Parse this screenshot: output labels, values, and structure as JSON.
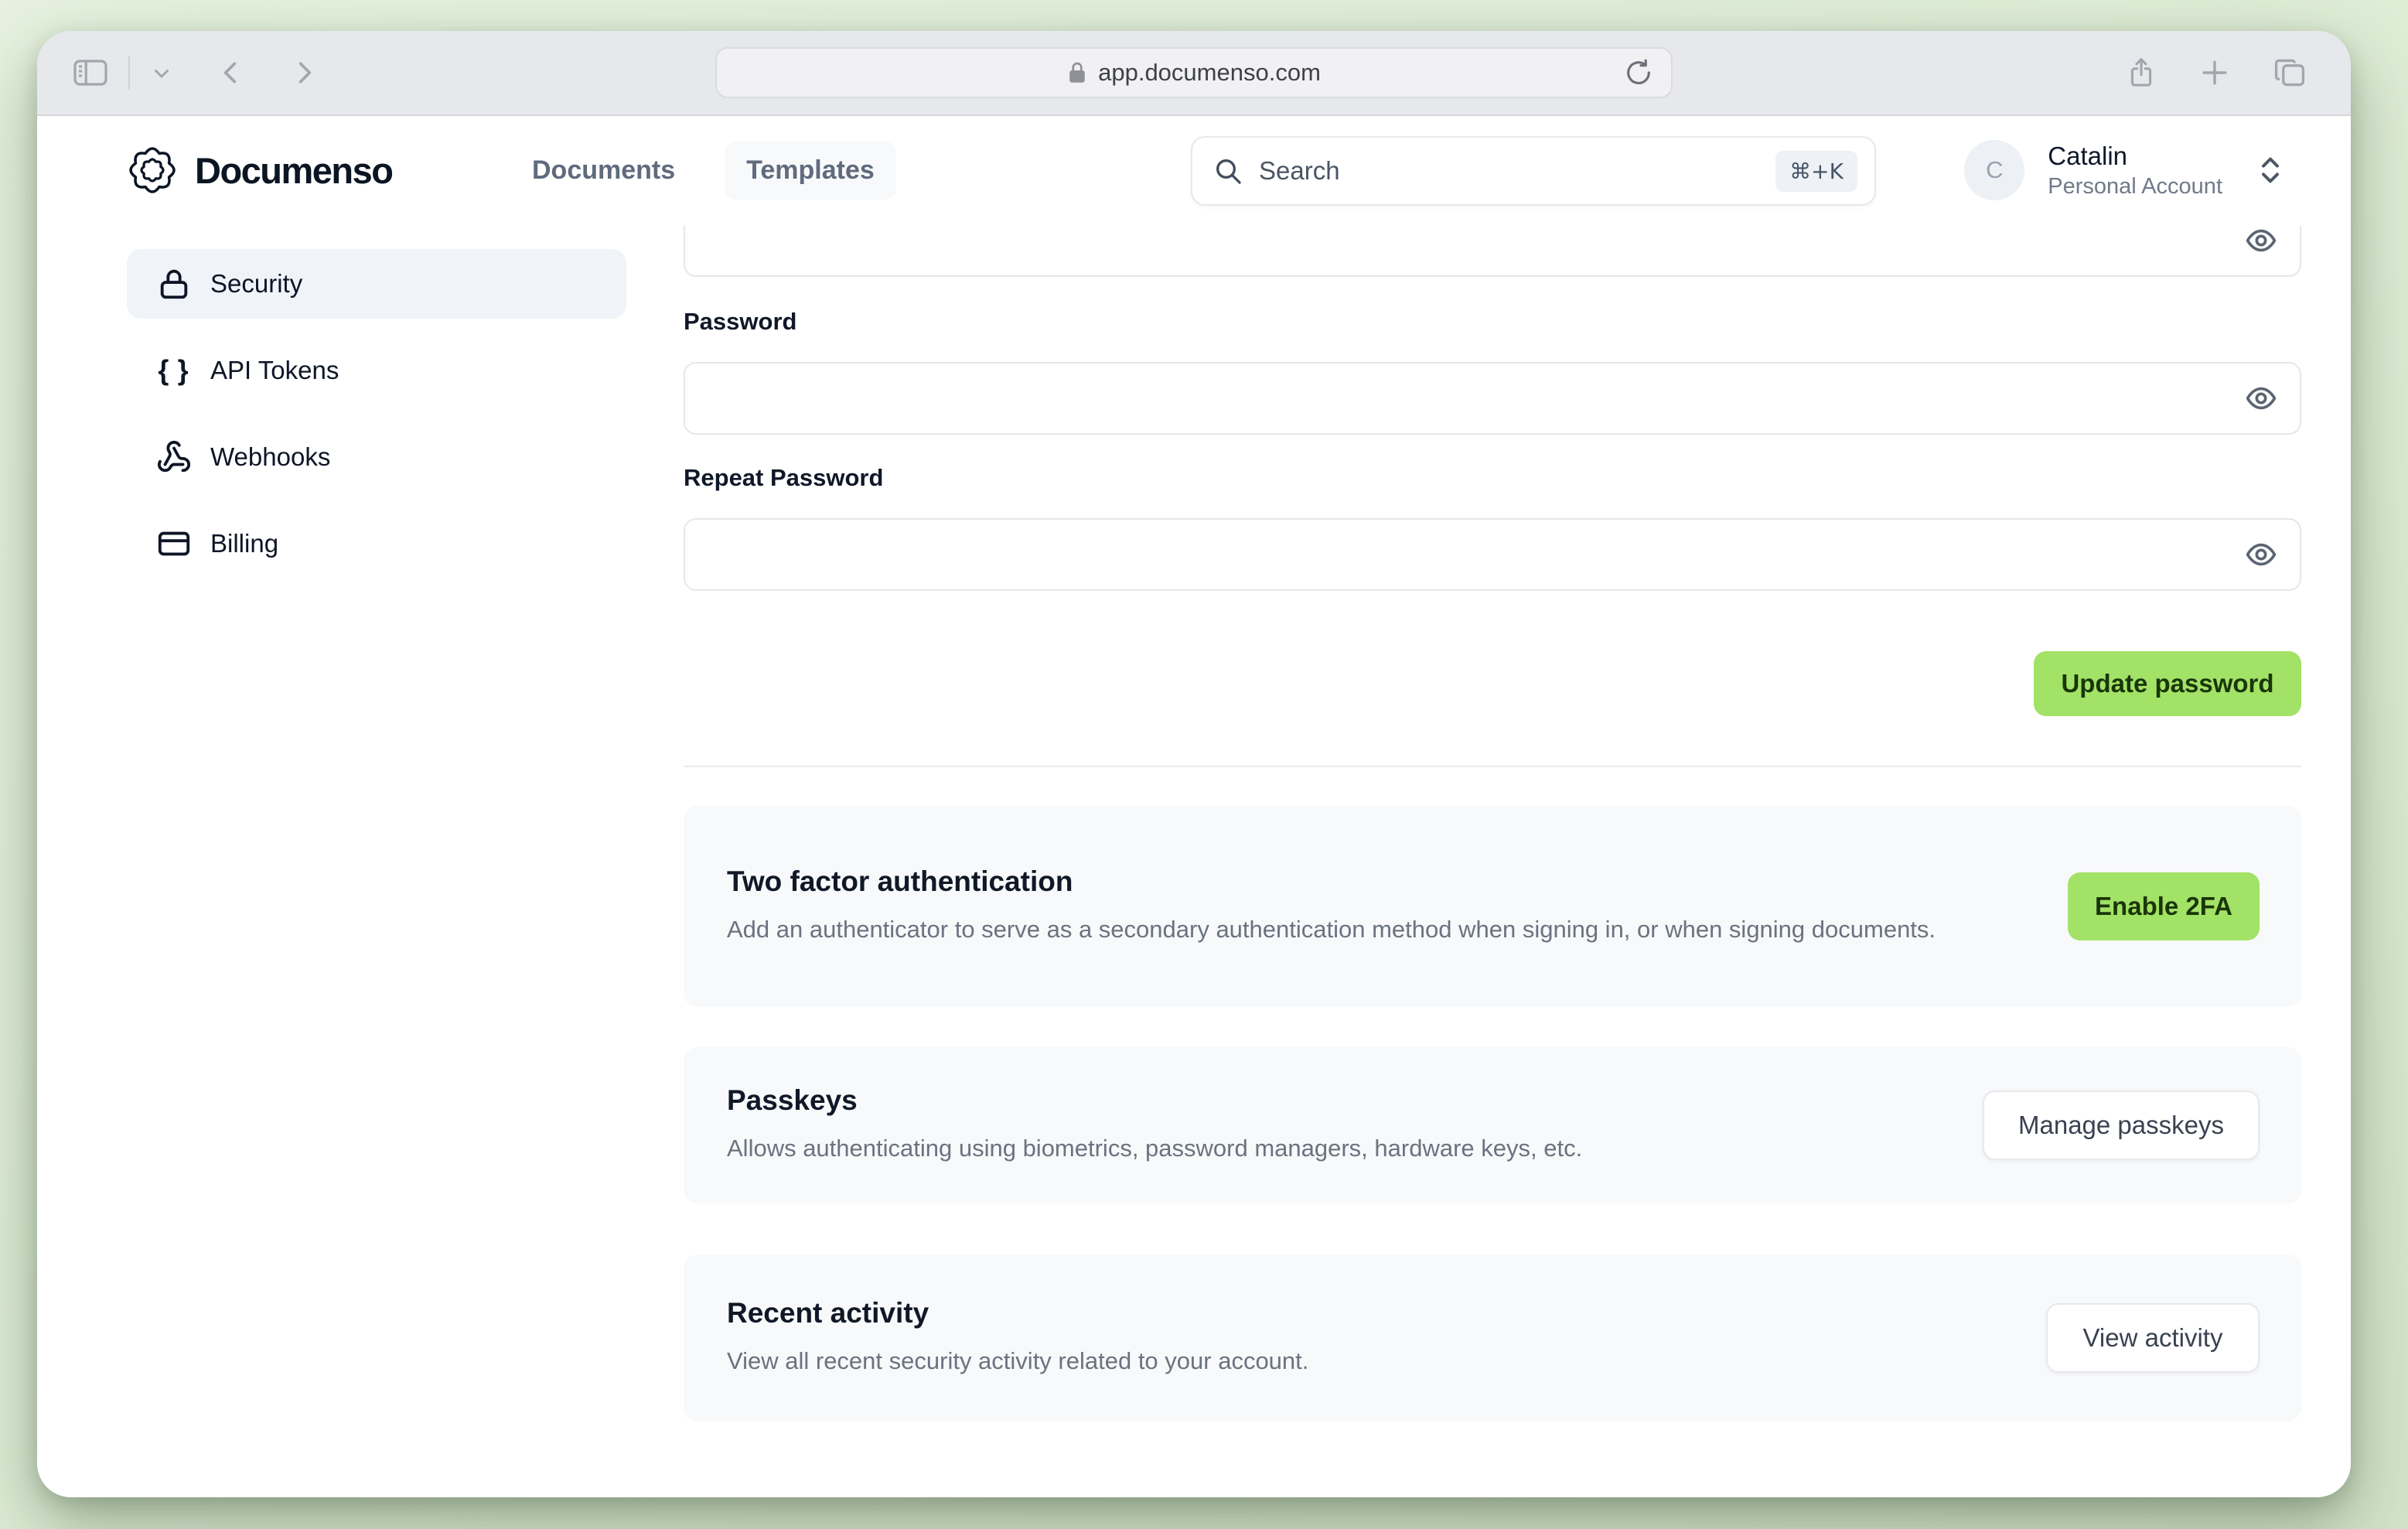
{
  "browser": {
    "url": "app.documenso.com",
    "icons": [
      "sidebar-toggle",
      "tab-group-chevron",
      "back",
      "forward",
      "page-lock",
      "reload",
      "share",
      "new-tab",
      "tab-overview"
    ]
  },
  "header": {
    "brand": "Documenso",
    "nav": [
      {
        "label": "Documents"
      },
      {
        "label": "Templates"
      }
    ],
    "search": {
      "placeholder": "Search",
      "shortcut": "⌘+K"
    },
    "account": {
      "initial": "C",
      "name": "Catalin",
      "type": "Personal Account"
    }
  },
  "sidebar": {
    "items": [
      {
        "label": "Security",
        "icon": "lock",
        "active": true
      },
      {
        "label": "API Tokens",
        "icon": "braces",
        "active": false
      },
      {
        "label": "Webhooks",
        "icon": "webhook",
        "active": false
      },
      {
        "label": "Billing",
        "icon": "credit-card",
        "active": false
      }
    ]
  },
  "form": {
    "password_label": "Password",
    "repeat_password_label": "Repeat Password",
    "password_value": "",
    "repeat_password_value": "",
    "submit_label": "Update password"
  },
  "sections": [
    {
      "title": "Two factor authentication",
      "description": "Add an authenticator to serve as a secondary authentication method when signing in, or when signing documents.",
      "button": "Enable 2FA",
      "button_style": "primary"
    },
    {
      "title": "Passkeys",
      "description": "Allows authenticating using biometrics, password managers, hardware keys, etc.",
      "button": "Manage passkeys",
      "button_style": "outline"
    },
    {
      "title": "Recent activity",
      "description": "View all recent security activity related to your account.",
      "button": "View activity",
      "button_style": "outline"
    }
  ],
  "colors": {
    "accent_green": "#a2e266",
    "accent_green_text": "#1a3609",
    "desktop_green": "#ddecd5",
    "toolbar_gray": "#e7e8eb",
    "card_bg": "#f7f9fa",
    "sidebar_active_bg": "#f0f3f8"
  }
}
